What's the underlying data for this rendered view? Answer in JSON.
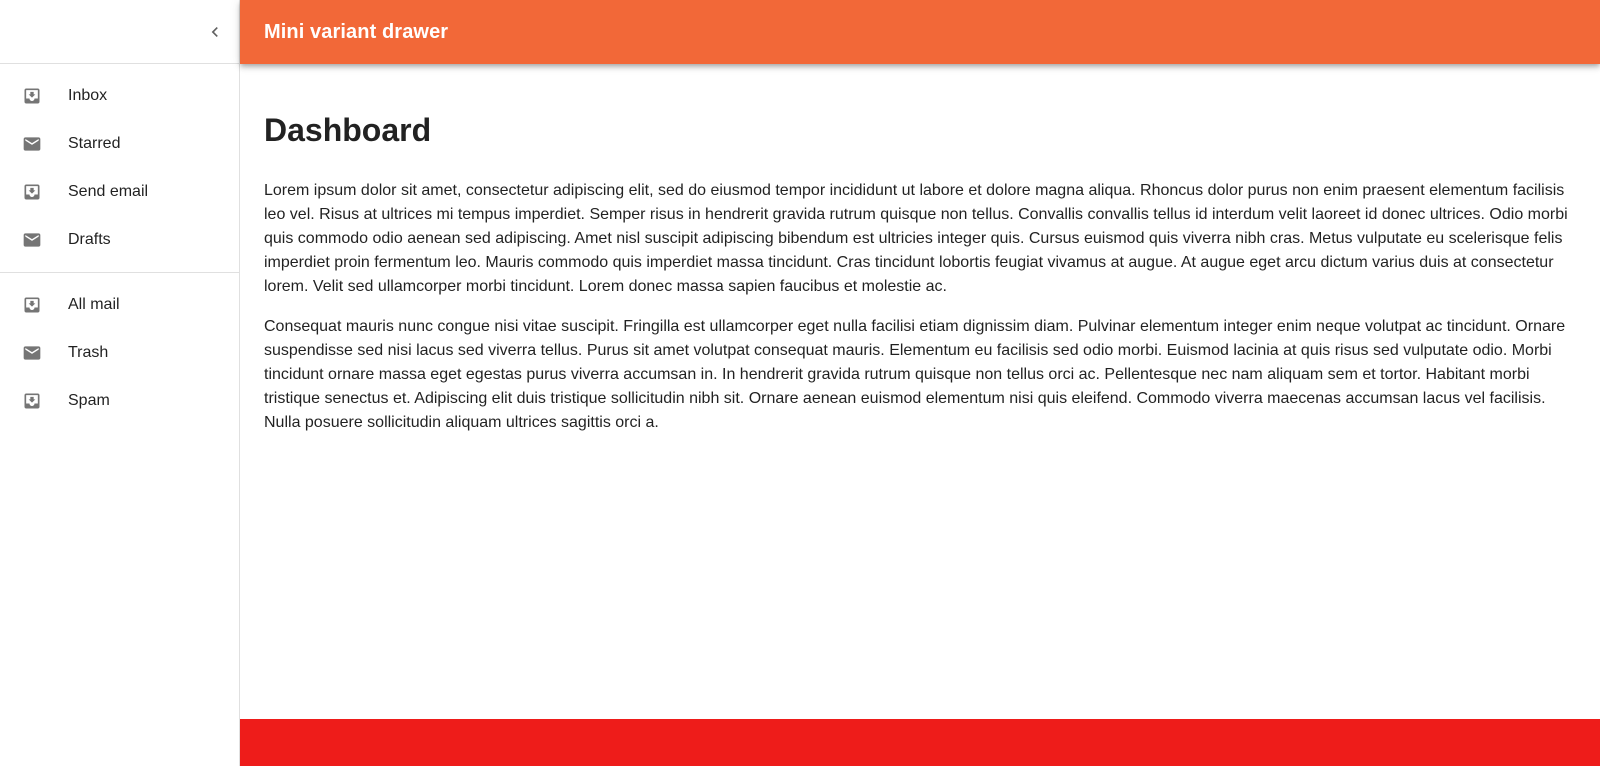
{
  "appbar": {
    "title": "Mini variant drawer",
    "color": "#f26838"
  },
  "drawer": {
    "collapse_icon": "chevron-left-icon",
    "primary_items": [
      {
        "label": "Inbox",
        "icon": "move-to-inbox-icon"
      },
      {
        "label": "Starred",
        "icon": "mail-icon"
      },
      {
        "label": "Send email",
        "icon": "move-to-inbox-icon"
      },
      {
        "label": "Drafts",
        "icon": "mail-icon"
      }
    ],
    "secondary_items": [
      {
        "label": "All mail",
        "icon": "move-to-inbox-icon"
      },
      {
        "label": "Trash",
        "icon": "mail-icon"
      },
      {
        "label": "Spam",
        "icon": "move-to-inbox-icon"
      }
    ]
  },
  "main": {
    "title": "Dashboard",
    "paragraphs": [
      "Lorem ipsum dolor sit amet, consectetur adipiscing elit, sed do eiusmod tempor incididunt ut labore et dolore magna aliqua. Rhoncus dolor purus non enim praesent elementum facilisis leo vel. Risus at ultrices mi tempus imperdiet. Semper risus in hendrerit gravida rutrum quisque non tellus. Convallis convallis tellus id interdum velit laoreet id donec ultrices. Odio morbi quis commodo odio aenean sed adipiscing. Amet nisl suscipit adipiscing bibendum est ultricies integer quis. Cursus euismod quis viverra nibh cras. Metus vulputate eu scelerisque felis imperdiet proin fermentum leo. Mauris commodo quis imperdiet massa tincidunt. Cras tincidunt lobortis feugiat vivamus at augue. At augue eget arcu dictum varius duis at consectetur lorem. Velit sed ullamcorper morbi tincidunt. Lorem donec massa sapien faucibus et molestie ac.",
      "Consequat mauris nunc congue nisi vitae suscipit. Fringilla est ullamcorper eget nulla facilisi etiam dignissim diam. Pulvinar elementum integer enim neque volutpat ac tincidunt. Ornare suspendisse sed nisi lacus sed viverra tellus. Purus sit amet volutpat consequat mauris. Elementum eu facilisis sed odio morbi. Euismod lacinia at quis risus sed vulputate odio. Morbi tincidunt ornare massa eget egestas purus viverra accumsan in. In hendrerit gravida rutrum quisque non tellus orci ac. Pellentesque nec nam aliquam sem et tortor. Habitant morbi tristique senectus et. Adipiscing elit duis tristique sollicitudin nibh sit. Ornare aenean euismod elementum nisi quis eleifend. Commodo viverra maecenas accumsan lacus vel facilisis. Nulla posuere sollicitudin aliquam ultrices sagittis orci a."
    ]
  },
  "footer": {
    "color": "#ee1c1a"
  }
}
